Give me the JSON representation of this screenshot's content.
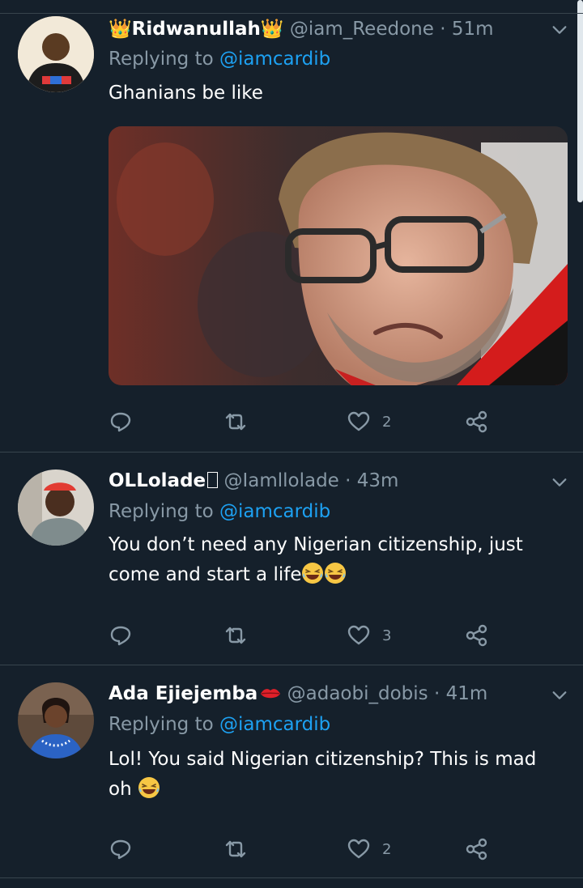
{
  "colors": {
    "background": "#15202b",
    "divider": "#38444d",
    "secondary_text": "#8899a6",
    "link": "#1da1f2"
  },
  "tweets": [
    {
      "name": "👑Ridwanullah👑",
      "handle": "@iam_Reedone",
      "dot": "·",
      "time": "51m",
      "replying_label": "Replying to",
      "replying_to": "@iamcardib",
      "text": "Ghanians be like",
      "has_media": true,
      "media_icon": "photo-of-frowning-man-with-glasses",
      "reply_icon": "reply-icon",
      "retweet_icon": "retweet-icon",
      "like_icon": "heart-icon",
      "like_count": "2",
      "share_icon": "share-icon"
    },
    {
      "name": "OLLolade",
      "handle": "@Iamllolade",
      "dot": "·",
      "time": "43m",
      "replying_label": "Replying to",
      "replying_to": "@iamcardib",
      "text_line1": "You don’t need any Nigerian citizenship, just",
      "text_line2": "come and start a life",
      "emoji": "laughing-face",
      "like_count": "3"
    },
    {
      "name": "Ada Ejiejemba",
      "handle": "@adaobi_dobis",
      "dot": "·",
      "time": "41m",
      "replying_label": "Replying to",
      "replying_to": "@iamcardib",
      "text_line1": "Lol! You said Nigerian citizenship? This is mad",
      "text_line2": "oh",
      "emoji": "laughing-face",
      "name_emoji": "lips-emoji",
      "like_count": "2"
    }
  ]
}
